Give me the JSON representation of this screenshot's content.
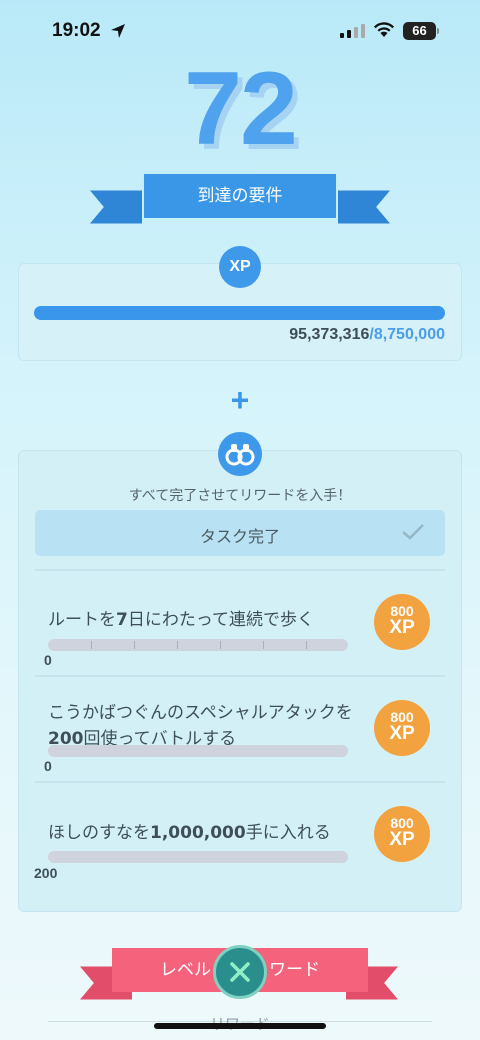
{
  "status_bar": {
    "time": "19:02",
    "battery": "66"
  },
  "level": "72",
  "requirements_label": "到達の要件",
  "xp": {
    "badge": "XP",
    "current": "95,373,316",
    "separator": "/",
    "target": "8,750,000",
    "progress_fraction": 1.0
  },
  "plus": "+",
  "tasks": {
    "subtitle": "すべて完了させてリワードを入手！",
    "complete_label": "タスク完了",
    "items": [
      {
        "title_a": "ルートを",
        "title_b": "7",
        "title_c": "日にわたって連続で歩く",
        "progress": "0",
        "reward_amount": "800",
        "reward_unit": "XP"
      },
      {
        "title_a": "こうかばつぐんのスペシャルアタックを",
        "title_b": "200",
        "title_c": "回使ってバトルする",
        "progress": "0",
        "reward_amount": "800",
        "reward_unit": "XP"
      },
      {
        "title_a": "ほしのすなを",
        "title_b": "1,000,000",
        "title_c": "手に入れる",
        "progress": "200",
        "reward_amount": "800",
        "reward_unit": "XP"
      }
    ]
  },
  "level_rewards": {
    "banner_left": "レベル",
    "banner_right": "ワード",
    "section_label": "リワード"
  },
  "colors": {
    "accent": "#3a96ea",
    "reward": "#f2a23f",
    "banner_pink": "#f4627c",
    "close": "#2a8e8c"
  }
}
